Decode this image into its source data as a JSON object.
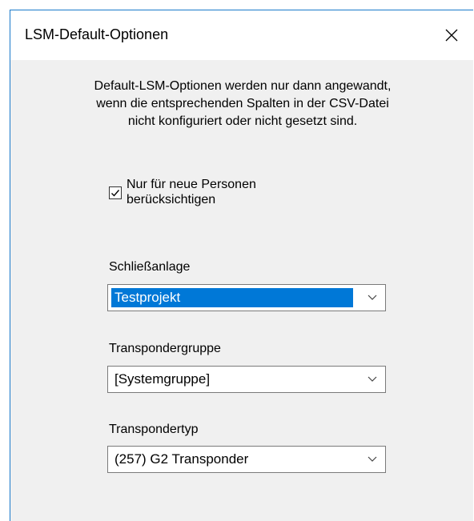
{
  "window": {
    "title": "LSM-Default-Optionen",
    "close_glyph": "✕"
  },
  "description": "Default-LSM-Optionen werden nur dann angewandt,\nwenn die entsprechenden Spalten in der CSV-Datei\nnicht konfiguriert oder nicht gesetzt sind.",
  "checkbox": {
    "label": "Nur für neue Personen\nberücksichtigen",
    "checked": true
  },
  "fields": [
    {
      "label": "Schließanlage",
      "value": "Testprojekt",
      "focused": true
    },
    {
      "label": "Transpondergruppe",
      "value": "[Systemgruppe]",
      "focused": false
    },
    {
      "label": "Transpondertyp",
      "value": "(257) G2 Transponder",
      "focused": false
    }
  ],
  "colors": {
    "selection": "#0078d7",
    "window_border": "#1979ca"
  }
}
